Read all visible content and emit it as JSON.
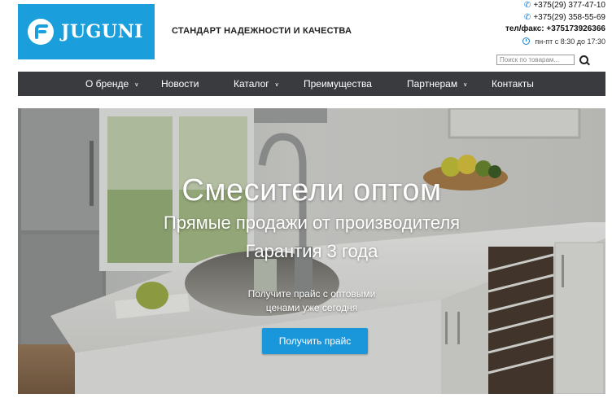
{
  "brand": {
    "logo_text": "JUGUNI",
    "tagline": "СТАНДАРТ НАДЕЖНОСТИ И КАЧЕСТВА",
    "accent": "#1a9fdc"
  },
  "contacts": {
    "phone1": "+375(29) 377-47-10",
    "phone2": "+375(29) 358-55-69",
    "fax": "тел/факс: +375173926366",
    "hours": "пн-пт с 8:30 до 17:30"
  },
  "search": {
    "placeholder": "Поиск по товарам..."
  },
  "nav": {
    "items": [
      "О бренде",
      "Новости",
      "Каталог",
      "Преимущества",
      "Партнерам",
      "Контакты"
    ]
  },
  "hero": {
    "title": "Смесители оптом",
    "subtitle1": "Прямые продажи от производителя",
    "subtitle2": "Гарантия 3 года",
    "note1": "Получите прайс с оптовыми",
    "note2": "ценами  уже сегодня",
    "button": "Получить прайс",
    "button_color": "#1a96db"
  }
}
